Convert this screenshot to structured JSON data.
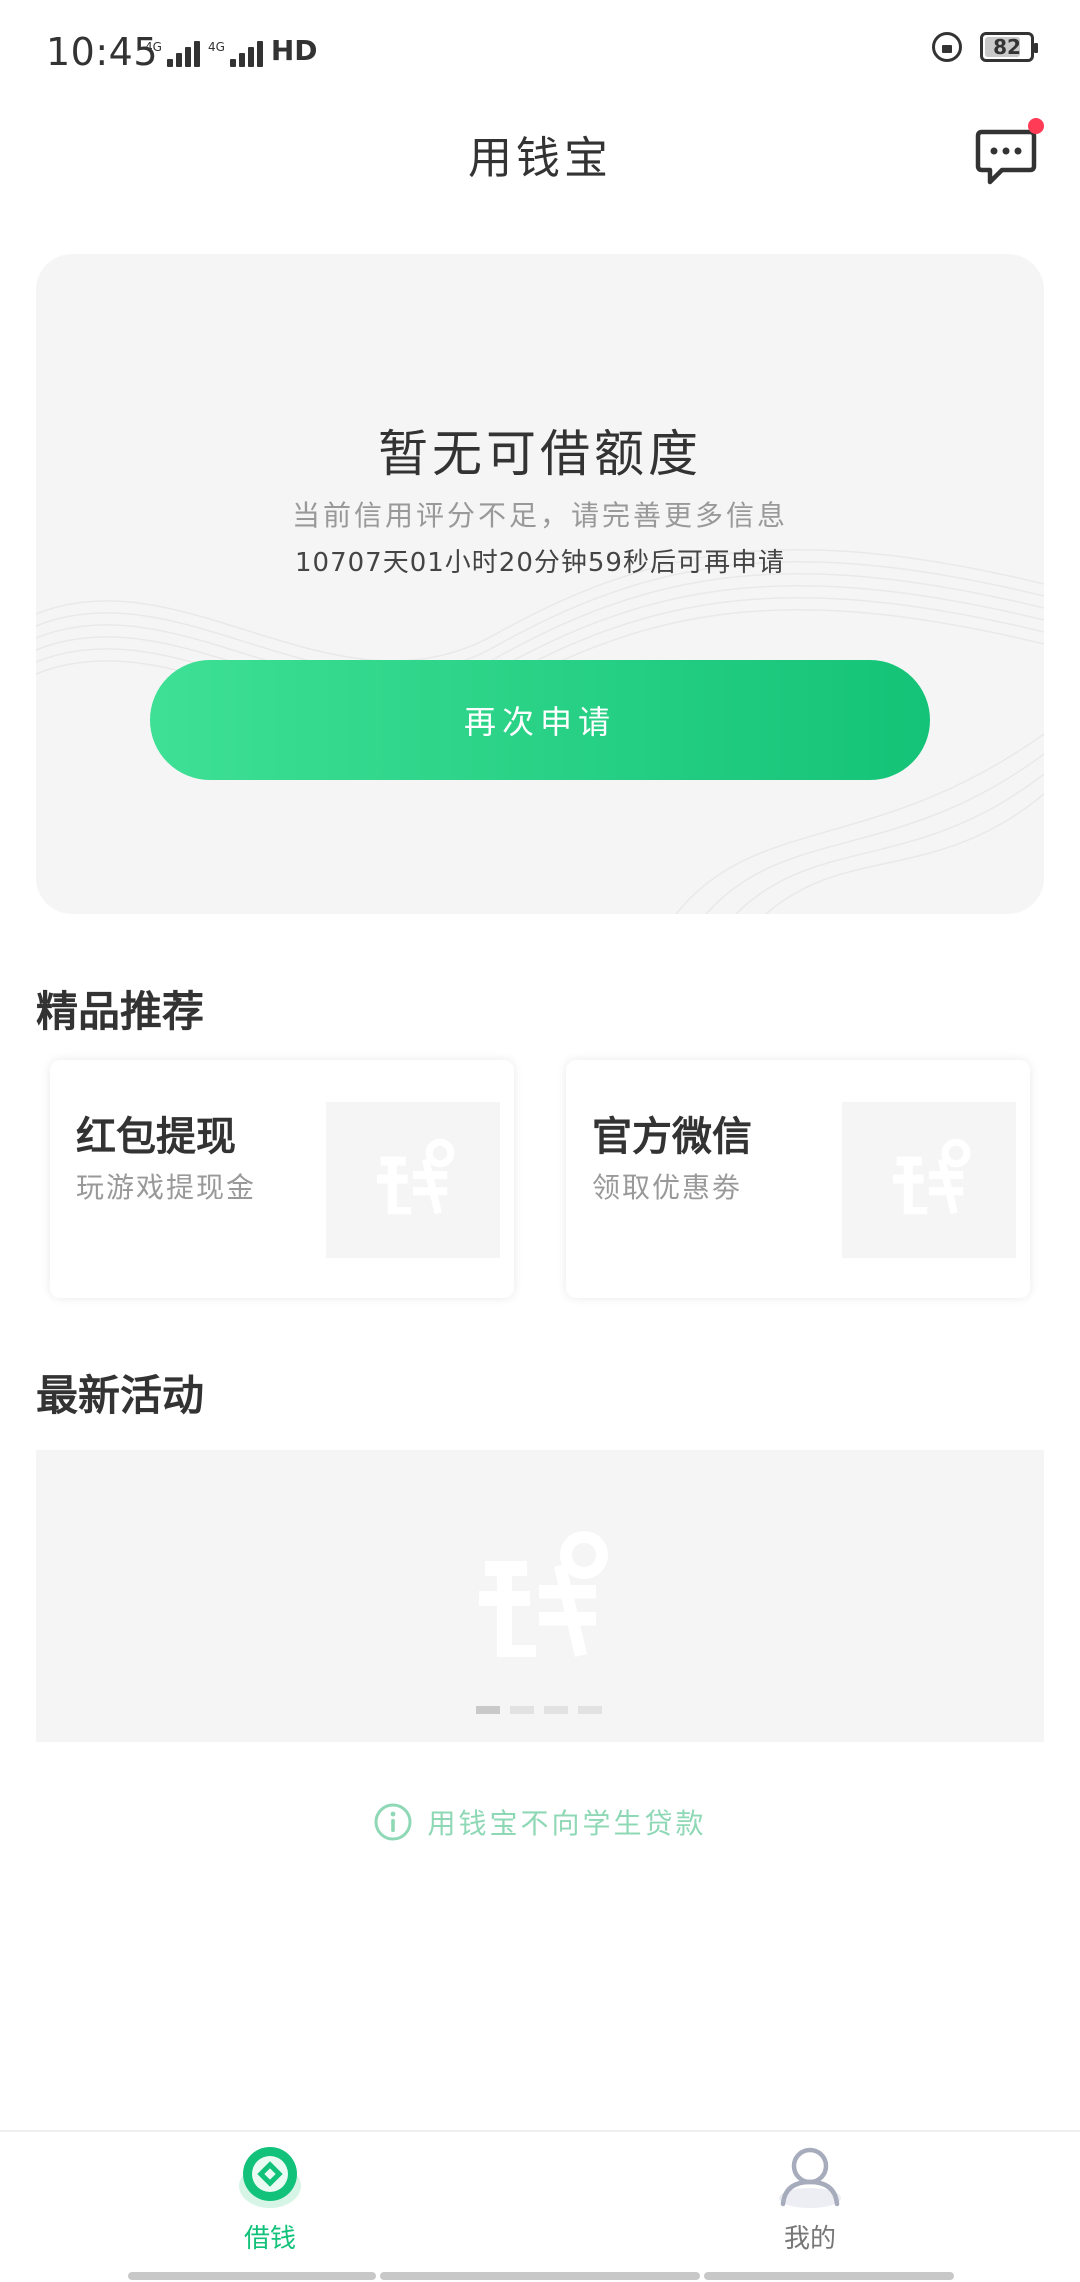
{
  "status_bar": {
    "time": "10:45",
    "network_1": "4G",
    "network_2": "4G",
    "hd_label": "HD",
    "battery": "82",
    "battery_level": 0.82
  },
  "header": {
    "title": "用钱宝"
  },
  "credit_card": {
    "title": "暂无可借额度",
    "subtitle": "当前信用评分不足，请完善更多信息",
    "countdown": "10707天01小时20分钟59秒后可再申请",
    "apply_button": "再次申请"
  },
  "recommend": {
    "section_title": "精品推荐",
    "items": [
      {
        "title": "红包提现",
        "subtitle": "玩游戏提现金"
      },
      {
        "title": "官方微信",
        "subtitle": "领取优惠劵"
      }
    ]
  },
  "activities": {
    "section_title": "最新活动"
  },
  "notice": {
    "text": "用钱宝不向学生贷款"
  },
  "tabs": [
    {
      "label": "借钱",
      "icon": "coin-icon",
      "active": true
    },
    {
      "label": "我的",
      "icon": "person-icon",
      "active": false
    }
  ],
  "colors": {
    "brand_green": "#13c27a",
    "button_gradient_start": "#3ee095",
    "button_gradient_end": "#14c377",
    "notification_dot": "#ff3b56",
    "notice_green": "#8fd8b6"
  }
}
